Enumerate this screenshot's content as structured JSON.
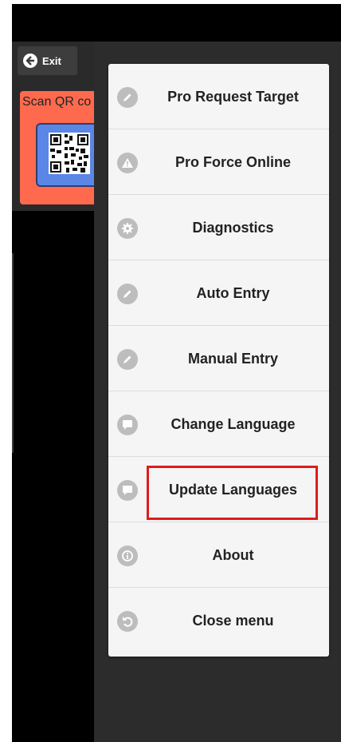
{
  "toolbar": {
    "exit_label": "Exit"
  },
  "scan_card": {
    "text": "Scan QR co"
  },
  "menu": {
    "items": [
      {
        "label": "Pro Request Target",
        "icon": "pencil-icon"
      },
      {
        "label": "Pro Force Online",
        "icon": "warning-icon"
      },
      {
        "label": "Diagnostics",
        "icon": "gear-icon"
      },
      {
        "label": "Auto Entry",
        "icon": "pencil-icon"
      },
      {
        "label": "Manual Entry",
        "icon": "pencil-icon"
      },
      {
        "label": "Change Language",
        "icon": "chat-bubble-icon"
      },
      {
        "label": "Update Languages",
        "icon": "chat-bubble-icon"
      },
      {
        "label": "About",
        "icon": "info-icon"
      },
      {
        "label": "Close menu",
        "icon": "undo-icon"
      }
    ],
    "highlighted_index": 6
  },
  "colors": {
    "scan_card": "#ff6a4f",
    "qr_box": "#5a86e6",
    "highlight_border": "#e01b1b",
    "menu_bg": "#f5f5f5",
    "icon_bg": "#bdbdbd"
  }
}
